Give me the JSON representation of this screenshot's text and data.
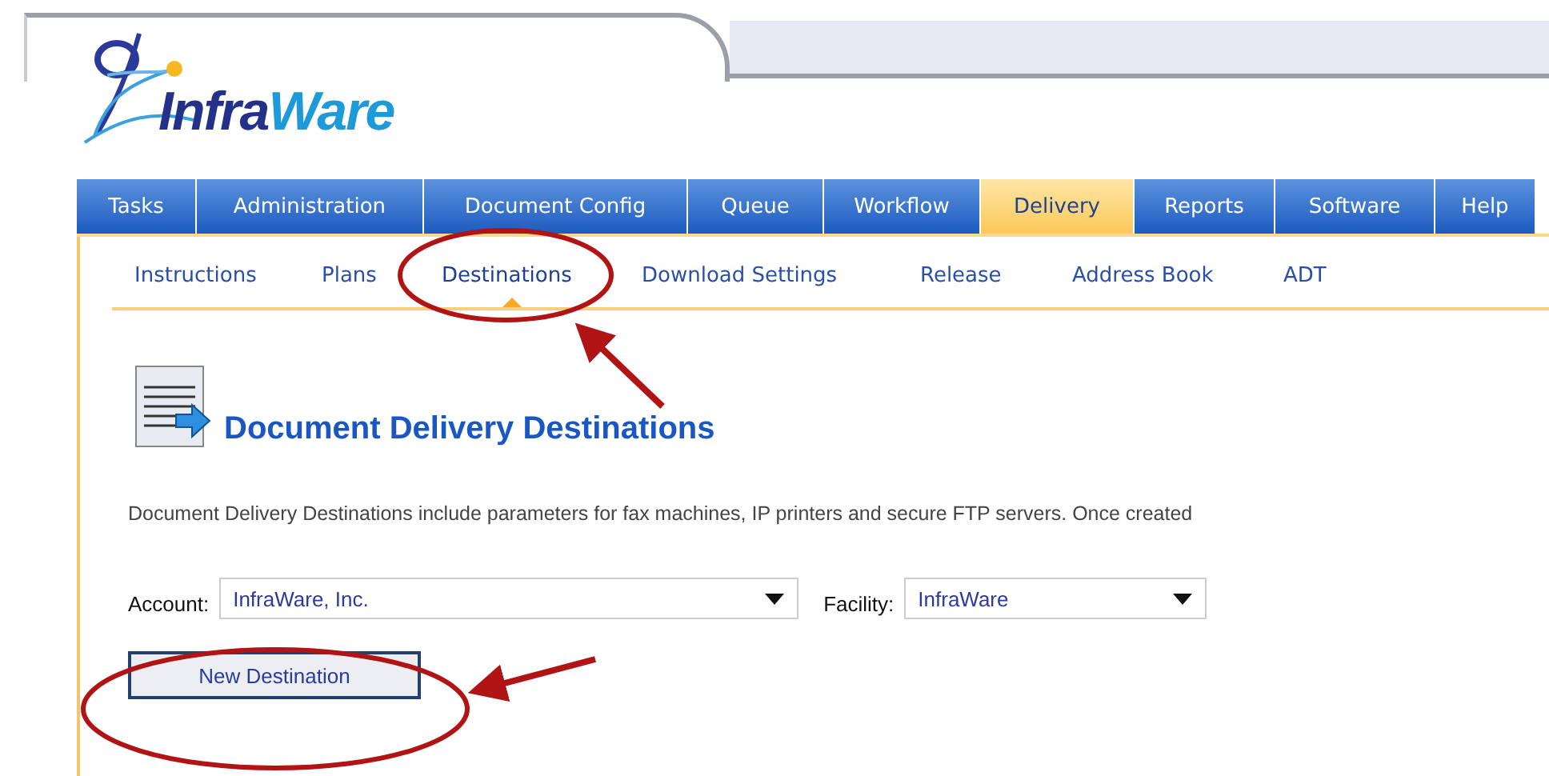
{
  "logo": {
    "parts": [
      "Infra",
      "Ware"
    ]
  },
  "tabs": [
    {
      "label": "Tasks",
      "selected": false
    },
    {
      "label": "Administration",
      "selected": false
    },
    {
      "label": "Document Config",
      "selected": false
    },
    {
      "label": "Queue",
      "selected": false
    },
    {
      "label": "Workflow",
      "selected": false
    },
    {
      "label": "Delivery",
      "selected": true
    },
    {
      "label": "Reports",
      "selected": false
    },
    {
      "label": "Software",
      "selected": false
    },
    {
      "label": "Help",
      "selected": false
    }
  ],
  "subnav": [
    {
      "label": "Instructions",
      "selected": false
    },
    {
      "label": "Plans",
      "selected": false
    },
    {
      "label": "Destinations",
      "selected": true
    },
    {
      "label": "Download Settings",
      "selected": false
    },
    {
      "label": "Release",
      "selected": false
    },
    {
      "label": "Address Book",
      "selected": false
    },
    {
      "label": "ADT",
      "selected": false
    }
  ],
  "page": {
    "heading": "Document Delivery Destinations",
    "description": "Document Delivery Destinations include parameters for fax machines, IP printers and secure FTP servers. Once created"
  },
  "filters": [
    {
      "label": "Account:",
      "value": "InfraWare, Inc."
    },
    {
      "label": "Facility:",
      "value": "InfraWare"
    }
  ],
  "button": "New Destination"
}
